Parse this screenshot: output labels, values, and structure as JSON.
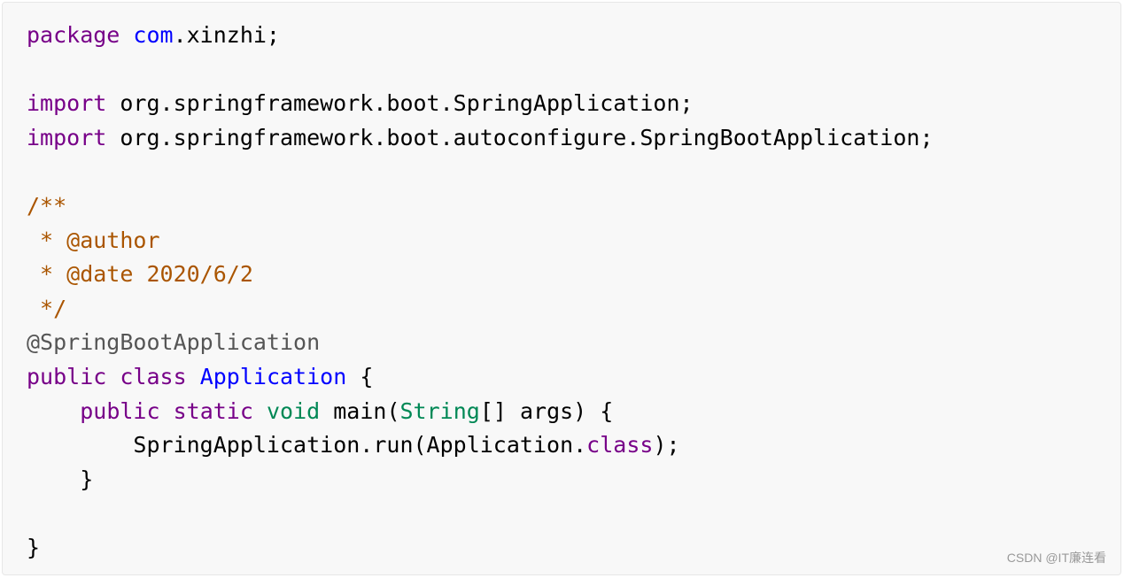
{
  "colors": {
    "keyword": "#770088",
    "package_name": "#0000ff",
    "class_name": "#0000ff",
    "type": "#008855",
    "comment": "#aa5500",
    "annotation": "#555555",
    "plain": "#000000",
    "background": "#f8f8f8"
  },
  "code": {
    "line1": {
      "kw": "package",
      "sp": " ",
      "pkg": "com",
      "rest": ".xinzhi;"
    },
    "line2": {},
    "line3": {
      "kw": "import",
      "rest": " org.springframework.boot.SpringApplication;"
    },
    "line4": {
      "kw": "import",
      "rest": " org.springframework.boot.autoconfigure.SpringBootApplication;"
    },
    "line5": {},
    "line6": {
      "comment": "/**"
    },
    "line7": {
      "comment": " * @author"
    },
    "line8": {
      "comment": " * @date 2020/6/2"
    },
    "line9": {
      "comment": " */"
    },
    "line10": {
      "annotation": "@SpringBootApplication"
    },
    "line11": {
      "kw1": "public",
      "sp1": " ",
      "kw2": "class",
      "sp2": " ",
      "cls": "Application",
      "rest": " {"
    },
    "line12": {
      "indent": "    ",
      "kw1": "public",
      "sp1": " ",
      "kw2": "static",
      "sp2": " ",
      "type1": "void",
      "mid": " main(",
      "type2": "String",
      "rest": "[] args) {"
    },
    "line13": {
      "indent": "        ",
      "rest1": "SpringApplication.run(Application.",
      "kw": "class",
      "rest2": ");"
    },
    "line14": {
      "text": "    }"
    },
    "line15": {},
    "line16": {
      "text": "}"
    }
  },
  "watermark": "CSDN @IT廉连看"
}
